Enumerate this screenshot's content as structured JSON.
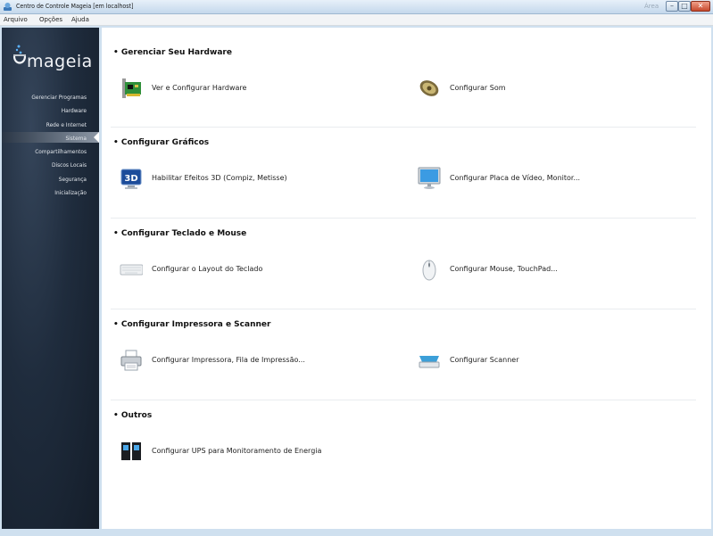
{
  "window": {
    "title": "Centro de Controle Mageia  [em localhost]",
    "ghost_text": "Área"
  },
  "menubar": [
    "Arquivo",
    "Opções",
    "Ajuda"
  ],
  "sidebar": {
    "logo_text": "mageia",
    "items": [
      {
        "label": "Gerenciar Programas"
      },
      {
        "label": "Hardware"
      },
      {
        "label": "Rede e Internet"
      },
      {
        "label": "Sistema"
      },
      {
        "label": "Compartilhamentos"
      },
      {
        "label": "Discos Locais"
      },
      {
        "label": "Segurança"
      },
      {
        "label": "Inicialização"
      }
    ],
    "active_item": "Hardware"
  },
  "sections": [
    {
      "title": "• Gerenciar Seu Hardware",
      "items": [
        {
          "label": "Ver e Configurar Hardware",
          "icon": "hardware-card-icon"
        },
        {
          "label": "Configurar Som",
          "icon": "speaker-icon"
        }
      ]
    },
    {
      "title": "• Configurar Gráficos",
      "items": [
        {
          "label": "Habilitar Efeitos 3D (Compiz, Metisse)",
          "icon": "3d-effects-icon"
        },
        {
          "label": "Configurar Placa de Vídeo, Monitor...",
          "icon": "monitor-icon"
        }
      ]
    },
    {
      "title": "• Configurar Teclado e Mouse",
      "items": [
        {
          "label": "Configurar o Layout do Teclado",
          "icon": "keyboard-icon"
        },
        {
          "label": "Configurar Mouse, TouchPad...",
          "icon": "mouse-icon"
        }
      ]
    },
    {
      "title": "• Configurar Impressora e Scanner",
      "items": [
        {
          "label": "Configurar Impressora, Fila de Impressão...",
          "icon": "printer-icon"
        },
        {
          "label": "Configurar Scanner",
          "icon": "scanner-icon"
        }
      ]
    },
    {
      "title": "• Outros",
      "items": [
        {
          "label": "Configurar UPS para Monitoramento de Energia",
          "icon": "ups-icon"
        }
      ]
    }
  ]
}
